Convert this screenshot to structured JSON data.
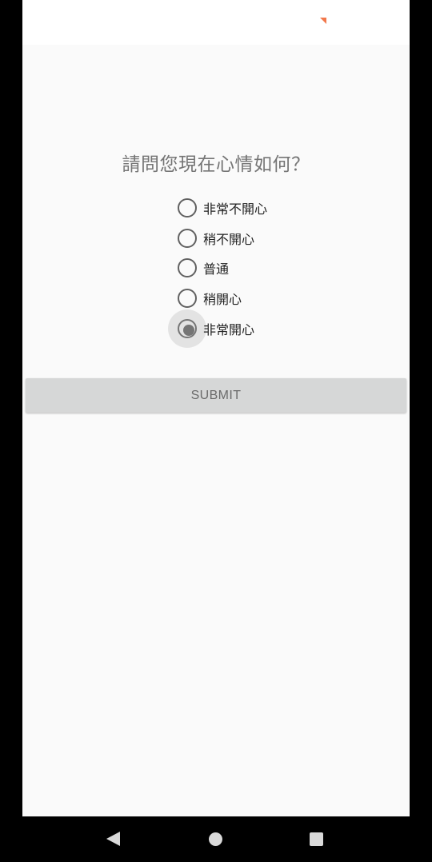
{
  "survey": {
    "question": "請問您現在心情如何？",
    "options": [
      {
        "label": "非常不開心",
        "checked": false
      },
      {
        "label": "稍不開心",
        "checked": false
      },
      {
        "label": "普通",
        "checked": false
      },
      {
        "label": "稍開心",
        "checked": false
      },
      {
        "label": "非常開心",
        "checked": true
      }
    ],
    "submit_label": "SUBMIT"
  },
  "nav_bar": {
    "back_icon": "triangle-back-icon",
    "home_icon": "circle-home-icon",
    "recents_icon": "square-recents-icon"
  },
  "colors": {
    "accent_marker": "#f2784b",
    "radio_checked": "#757575",
    "button_bg": "#d6d7d7"
  }
}
